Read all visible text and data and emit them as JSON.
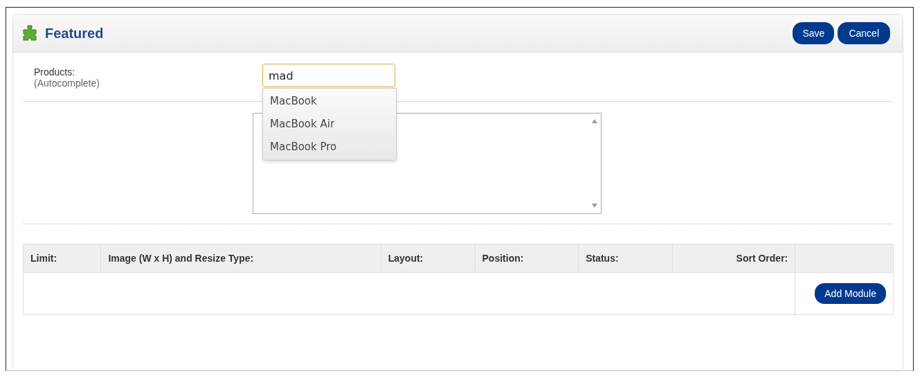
{
  "header": {
    "title": "Featured",
    "buttons": [
      "Save",
      "Cancel"
    ]
  },
  "products": {
    "label": "Products:",
    "hint": "(Autocomplete)",
    "value": "mad",
    "suggestions": [
      {
        "label": "MacBook"
      },
      {
        "label": "MacBook Air"
      },
      {
        "label": "MacBook Pro"
      }
    ]
  },
  "modules_table": {
    "columns": [
      "Limit:",
      "Image (W x H) and Resize Type:",
      "Layout:",
      "Position:",
      "Status:",
      "Sort Order:"
    ],
    "add_button": "Add Module"
  }
}
